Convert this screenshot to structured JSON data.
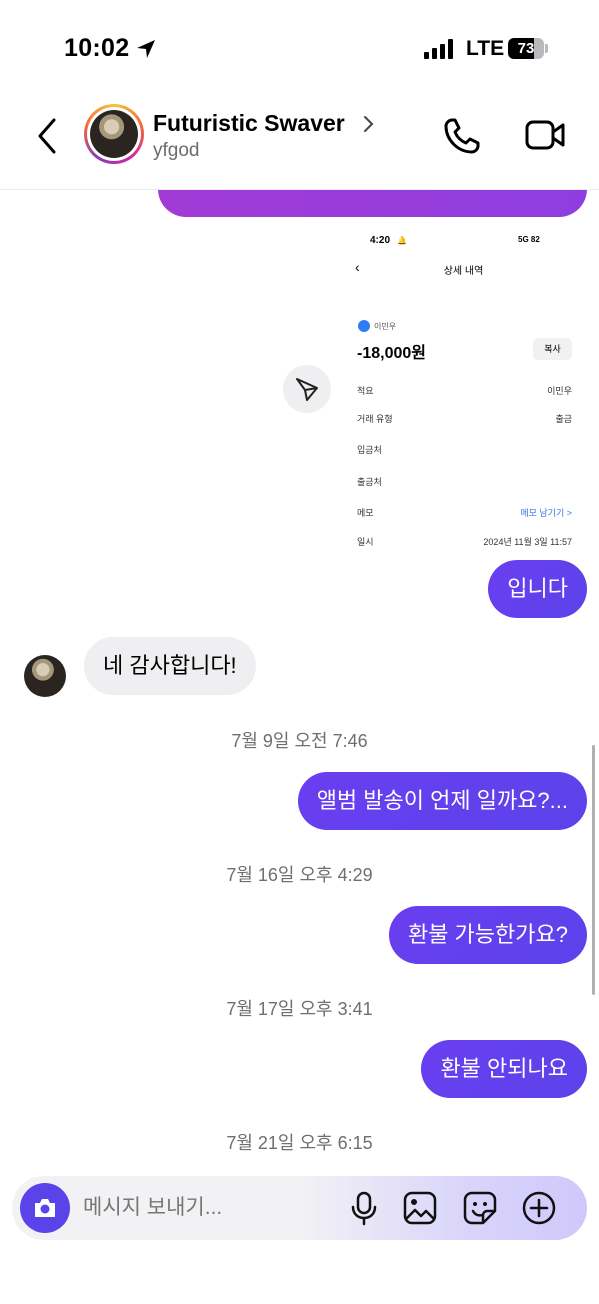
{
  "status_bar": {
    "time": "10:02",
    "network": "LTE",
    "battery_level": 73,
    "battery_text": "73"
  },
  "header": {
    "contact_name": "Futuristic Swaver",
    "handle": "yfgod",
    "icons": [
      "back-icon",
      "chevron-right-icon",
      "phone-icon",
      "video-camera-icon"
    ]
  },
  "attachment": {
    "time": "4:20",
    "status": "5G 82",
    "title": "상세 내역",
    "bank_name": "이민우",
    "amount": "-18,000원",
    "copy_label": "복사",
    "rows": [
      {
        "key": "적요",
        "value": "이민우"
      },
      {
        "key": "거래 유형",
        "value": "출금"
      },
      {
        "key": "입금처",
        "value": ""
      },
      {
        "key": "출금처",
        "value": ""
      },
      {
        "key": "메모",
        "value": "메모 남기기 >"
      },
      {
        "key": "일시",
        "value": "2024년 11월 3일 11:57"
      }
    ]
  },
  "messages": [
    {
      "type": "out",
      "text": "입니다"
    },
    {
      "type": "in",
      "text": "네 감사합니다!"
    },
    {
      "type": "timestamp",
      "text": "7월 9일 오전 7:46"
    },
    {
      "type": "out",
      "text": "앨범 발송이 언제 일까요?..."
    },
    {
      "type": "timestamp",
      "text": "7월 16일 오후 4:29"
    },
    {
      "type": "out",
      "text": "환불 가능한가요?"
    },
    {
      "type": "timestamp",
      "text": "7월 17일 오후 3:41"
    },
    {
      "type": "out",
      "text": "환불 안되나요"
    },
    {
      "type": "timestamp",
      "text": "7월 21일 오후 6:15"
    }
  ],
  "composer": {
    "placeholder": "메시지 보내기...",
    "icons": [
      "camera-icon",
      "microphone-icon",
      "gallery-icon",
      "sticker-icon",
      "plus-icon"
    ]
  },
  "colors": {
    "accent": "#5b43ea",
    "accent_gradient_top": "#a23bd6"
  }
}
